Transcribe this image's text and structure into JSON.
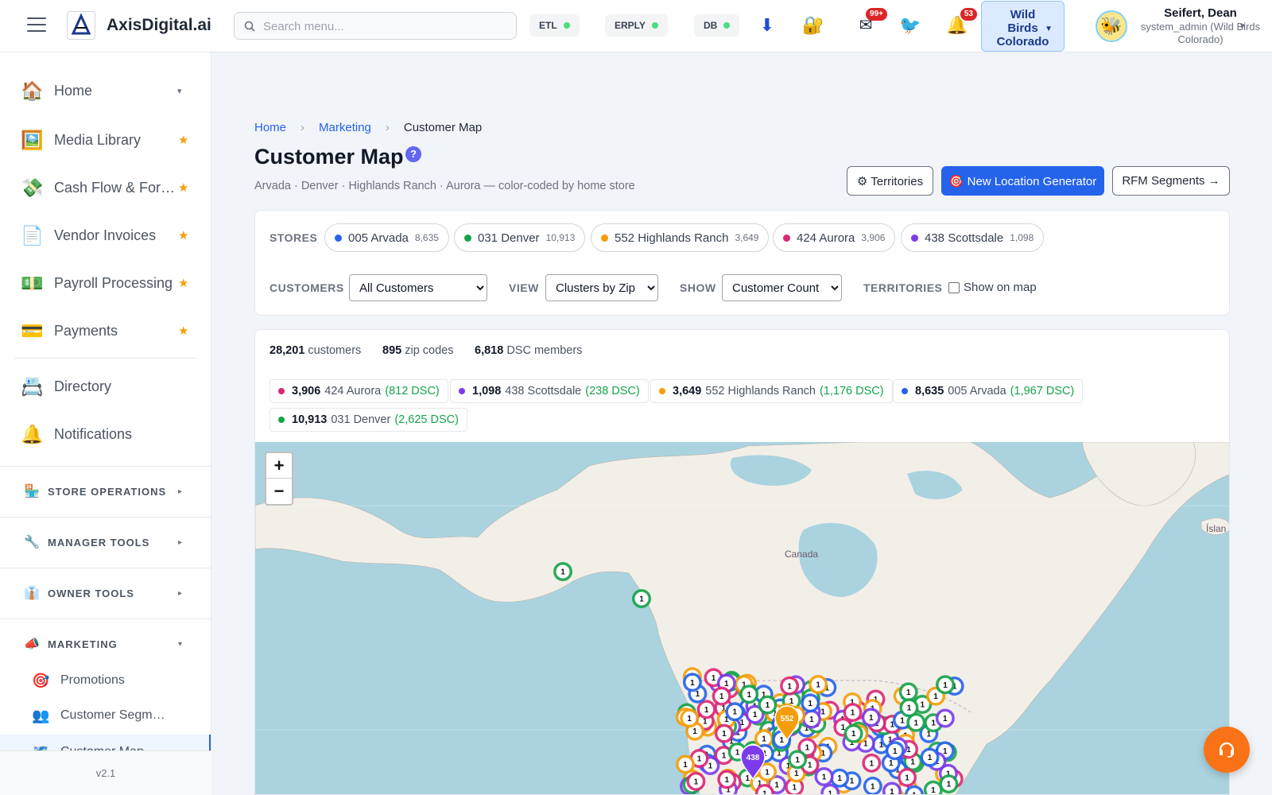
{
  "header": {
    "brand": "AxisDigital.ai",
    "search_placeholder": "Search menu...",
    "status": [
      {
        "label": "ETL",
        "color": "#4ade80"
      },
      {
        "label": "ERPLY",
        "color": "#4ade80"
      },
      {
        "label": "DB",
        "color": "#4ade80"
      }
    ],
    "mail_badge": "99+",
    "bell_badge": "53",
    "store_switcher": "Wild Birds Colorado",
    "user_name": "Seifert, Dean",
    "user_role": "system_admin (Wild Birds Colorado)"
  },
  "sidebar": {
    "items": [
      {
        "label": "Home",
        "icon": "home-icon",
        "caret": "▾"
      },
      {
        "label": "Media Library",
        "icon": "picture-icon",
        "star": "★"
      },
      {
        "label": "Cash Flow & For…",
        "icon": "money-flow-icon",
        "star": "★"
      },
      {
        "label": "Vendor Invoices",
        "icon": "document-icon",
        "star": "★"
      },
      {
        "label": "Payroll Processing",
        "icon": "banknote-icon",
        "star": "★"
      },
      {
        "label": "Payments",
        "icon": "credit-card-icon",
        "star": "★"
      },
      {
        "label": "Directory",
        "icon": "rolodex-icon"
      },
      {
        "label": "Notifications",
        "icon": "bell-icon"
      }
    ],
    "sections": [
      {
        "label": "STORE OPERATIONS",
        "caret": "▸"
      },
      {
        "label": "MANAGER TOOLS",
        "caret": "▸"
      },
      {
        "label": "OWNER TOOLS",
        "caret": "▸"
      },
      {
        "label": "MARKETING",
        "caret": "▾"
      }
    ],
    "marketing_items": [
      {
        "label": "Promotions"
      },
      {
        "label": "Customer Segm…"
      },
      {
        "label": "Customer Map"
      }
    ],
    "version": "v2.1"
  },
  "breadcrumb": {
    "home": "Home",
    "marketing": "Marketing",
    "current": "Customer Map"
  },
  "page": {
    "title": "Customer Map",
    "help": "?",
    "subtitle": "Arvada · Denver · Highlands Ranch · Aurora — color-coded by home store",
    "buttons": {
      "territories": "⚙ Territories",
      "new_location": "🎯 New Location Generator",
      "rfm": "RFM Segments →"
    }
  },
  "filters": {
    "stores_label": "STORES",
    "stores": [
      {
        "name": "005 Arvada",
        "count": "8,635",
        "color": "#2563eb"
      },
      {
        "name": "031 Denver",
        "count": "10,913",
        "color": "#16a34a"
      },
      {
        "name": "552 Highlands Ranch",
        "count": "3,649",
        "color": "#f59e0b"
      },
      {
        "name": "424 Aurora",
        "count": "3,906",
        "color": "#db2777"
      },
      {
        "name": "438 Scottsdale",
        "count": "1,098",
        "color": "#7c3aed"
      }
    ],
    "customers_label": "CUSTOMERS",
    "customers_value": "All Customers",
    "view_label": "VIEW",
    "view_value": "Clusters by Zip",
    "show_label": "SHOW",
    "show_value": "Customer Count",
    "territories_label": "TERRITORIES",
    "territories_checkbox": "Show on map"
  },
  "stats": {
    "customers": "28,201",
    "customers_label": "customers",
    "zips": "895",
    "zips_label": "zip codes",
    "dsc": "6,818",
    "dsc_label": "DSC members",
    "store_breakdown": [
      {
        "count": "3,906",
        "name": "424 Aurora",
        "dsc": "(812 DSC)",
        "color": "#db2777"
      },
      {
        "count": "1,098",
        "name": "438 Scottsdale",
        "dsc": "(238 DSC)",
        "color": "#7c3aed"
      },
      {
        "count": "3,649",
        "name": "552 Highlands Ranch",
        "dsc": "(1,176 DSC)",
        "color": "#f59e0b"
      },
      {
        "count": "8,635",
        "name": "005 Arvada",
        "dsc": "(1,967 DSC)",
        "color": "#2563eb"
      },
      {
        "count": "10,913",
        "name": "031 Denver",
        "dsc": "(2,625 DSC)",
        "color": "#16a34a"
      }
    ]
  },
  "map": {
    "zoom_in": "+",
    "zoom_out": "−",
    "label_canada": "Canada",
    "label_island": "Íslan",
    "cluster_label": "1",
    "store_pins": [
      {
        "label": "552",
        "color": "#f59e0b"
      },
      {
        "label": "438",
        "color": "#7c3aed"
      }
    ]
  }
}
